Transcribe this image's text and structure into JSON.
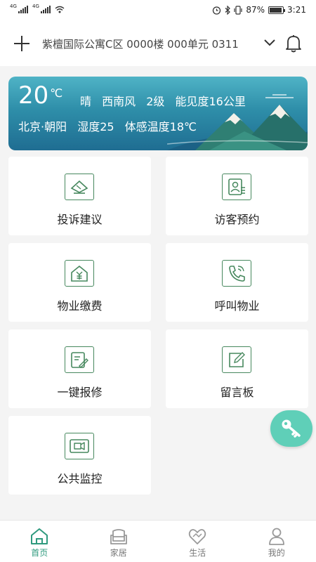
{
  "status_bar": {
    "network1": "4G",
    "network2": "4G",
    "battery": "87%",
    "battery_level": 0.87,
    "time": "3:21"
  },
  "header": {
    "address": "紫檀国际公寓C区 0000楼 000单元 0311"
  },
  "weather": {
    "temperature": "20",
    "unit": "℃",
    "condition": "晴",
    "wind_direction": "西南风",
    "wind_level": "2级",
    "visibility": "能见度16公里",
    "location": "北京·朝阳",
    "humidity": "湿度25",
    "feels_like": "体感温度18℃"
  },
  "services": [
    {
      "label": "投诉建议",
      "icon": "complaint-icon"
    },
    {
      "label": "访客预约",
      "icon": "visitor-icon"
    },
    {
      "label": "物业缴费",
      "icon": "payment-icon"
    },
    {
      "label": "呼叫物业",
      "icon": "phone-call-icon"
    },
    {
      "label": "一键报修",
      "icon": "repair-icon"
    },
    {
      "label": "留言板",
      "icon": "message-board-icon"
    },
    {
      "label": "公共监控",
      "icon": "camera-icon"
    }
  ],
  "tabs": [
    {
      "label": "首页",
      "icon": "home-icon",
      "active": true
    },
    {
      "label": "家居",
      "icon": "sofa-icon",
      "active": false
    },
    {
      "label": "生活",
      "icon": "handshake-icon",
      "active": false
    },
    {
      "label": "我的",
      "icon": "user-icon",
      "active": false
    }
  ],
  "colors": {
    "accent": "#2f9a7e",
    "icon_green": "#47885e",
    "fab": "#5fcfb8",
    "weather_top": "#4fb3c6",
    "weather_bottom": "#1f6d92"
  }
}
